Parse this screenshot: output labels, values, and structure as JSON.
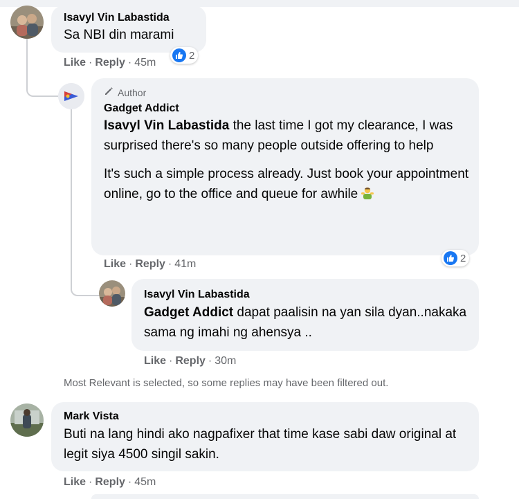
{
  "comments": [
    {
      "author": "Isavyl Vin Labastida",
      "text": "Sa NBI din marami",
      "actions": {
        "like": "Like",
        "reply": "Reply",
        "time": "45m"
      },
      "reactions": {
        "icon": "like-icon",
        "count": "2"
      },
      "replies": [
        {
          "badge": "Author",
          "author": "Gadget Addict",
          "paragraph1": {
            "mention": "Isavyl Vin Labastida",
            "rest": " the last time I got my clearance, I was surprised there's so many people outside offering to help"
          },
          "paragraph2": "It's such a simple process already. Just book your appointment online, go to the office and queue for awhile",
          "emoji": "person-gesturing-emoji",
          "actions": {
            "like": "Like",
            "reply": "Reply",
            "time": "41m"
          },
          "reactions": {
            "icon": "like-icon",
            "count": "2"
          }
        },
        {
          "author": "Isavyl Vin Labastida",
          "mention": "Gadget Addict",
          "rest": " dapat paalisin na yan sila dyan..nakaka sama ng imahi ng ahensya ..",
          "actions": {
            "like": "Like",
            "reply": "Reply",
            "time": "30m"
          }
        }
      ]
    },
    {
      "author": "Mark Vista",
      "text": "Buti na lang hindi ako nagpafixer that time kase sabi daw original at legit siya 4500 singil sakin.",
      "actions": {
        "like": "Like",
        "reply": "Reply",
        "time": "45m"
      }
    }
  ],
  "filter_note": "Most Relevant is selected, so some replies may have been filtered out.",
  "colors": {
    "bubble": "#f0f2f5",
    "like_blue": "#1877f2",
    "meta_gray": "#65676b"
  }
}
